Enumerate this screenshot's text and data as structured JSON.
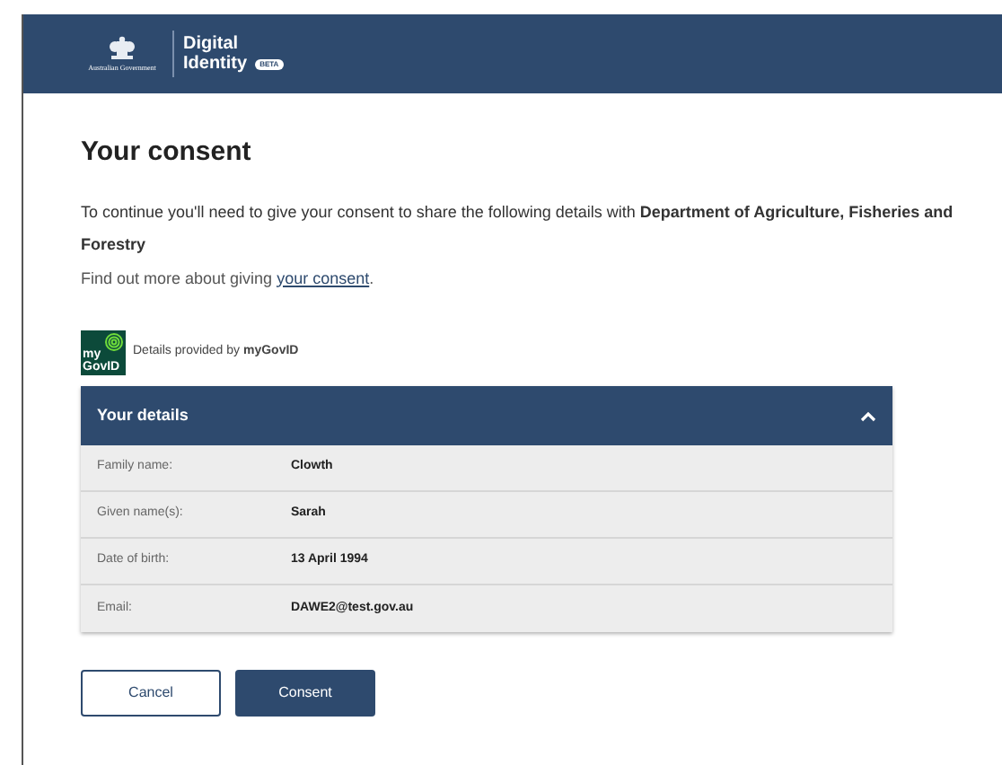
{
  "header": {
    "government": "Australian Government",
    "product_line_1": "Digital",
    "product_line_2": "Identity",
    "badge": "BETA"
  },
  "title": "Your consent",
  "intro": "To continue you'll need to give your consent to share the following details with **Department of Agriculture, Fisheries and Forestry**",
  "more_info": {
    "text": "Find out more about giving ",
    "link": "your consent",
    "suffix": "."
  },
  "provider": {
    "logo_line_1": "my",
    "logo_line_2": "GovID",
    "text": "Details provided by **myGovID**"
  },
  "details": {
    "title": "Your details",
    "expanded": true,
    "rows": [
      {
        "label": "Family name:",
        "value": "Clowth"
      },
      {
        "label": "Given name(s):",
        "value": "Sarah"
      },
      {
        "label": "Date of birth:",
        "value": "13 April 1994"
      },
      {
        "label": "Email:",
        "value": "DAWE2@test.gov.au"
      }
    ]
  },
  "buttons": [
    {
      "label": "Cancel",
      "kind": "secondary"
    },
    {
      "label": "Consent",
      "kind": "primary"
    }
  ]
}
